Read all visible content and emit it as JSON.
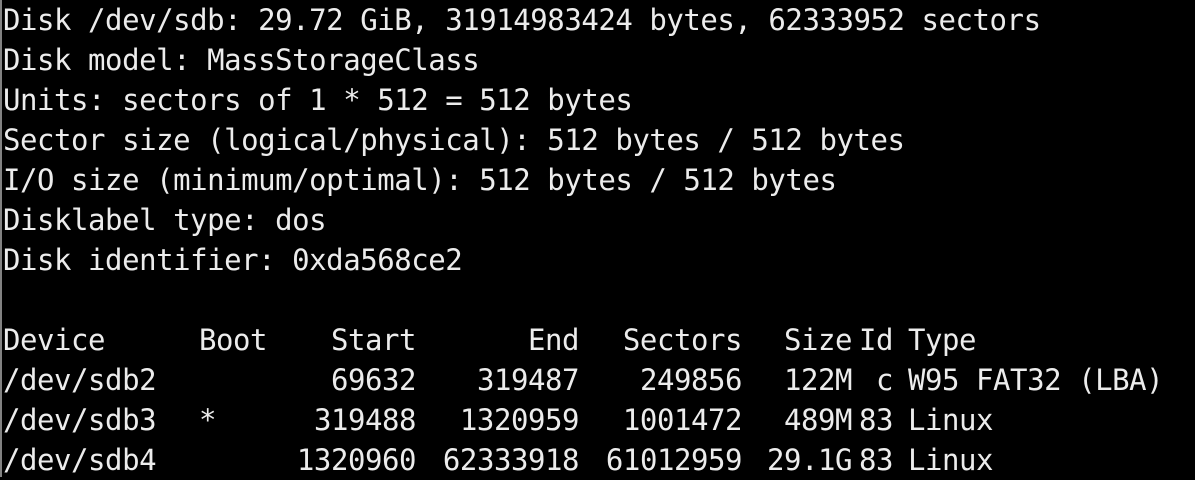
{
  "terminal": {
    "disk_summary": "Disk /dev/sdb: 29.72 GiB, 31914983424 bytes, 62333952 sectors",
    "disk_model": "Disk model: MassStorageClass",
    "units": "Units: sectors of 1 * 512 = 512 bytes",
    "sector_size": "Sector size (logical/physical): 512 bytes / 512 bytes",
    "io_size": "I/O size (minimum/optimal): 512 bytes / 512 bytes",
    "disklabel_type": "Disklabel type: dos",
    "disk_identifier": "Disk identifier: 0xda568ce2"
  },
  "partition_table": {
    "headers": {
      "device": "Device",
      "boot": "Boot",
      "start": "Start",
      "end": "End",
      "sectors": "Sectors",
      "size": "Size",
      "id": "Id",
      "type": "Type"
    },
    "rows": [
      {
        "device": "/dev/sdb2",
        "boot": "",
        "start": "69632",
        "end": "319487",
        "sectors": "249856",
        "size": "122M",
        "id": "c",
        "type": "W95 FAT32 (LBA)"
      },
      {
        "device": "/dev/sdb3",
        "boot": "*",
        "start": "319488",
        "end": "1320959",
        "sectors": "1001472",
        "size": "489M",
        "id": "83",
        "type": "Linux"
      },
      {
        "device": "/dev/sdb4",
        "boot": "",
        "start": "1320960",
        "end": "62333918",
        "sectors": "61012959",
        "size": "29.1G",
        "id": "83",
        "type": "Linux"
      }
    ]
  },
  "colors": {
    "background": "#000000",
    "foreground": "#ececec"
  }
}
